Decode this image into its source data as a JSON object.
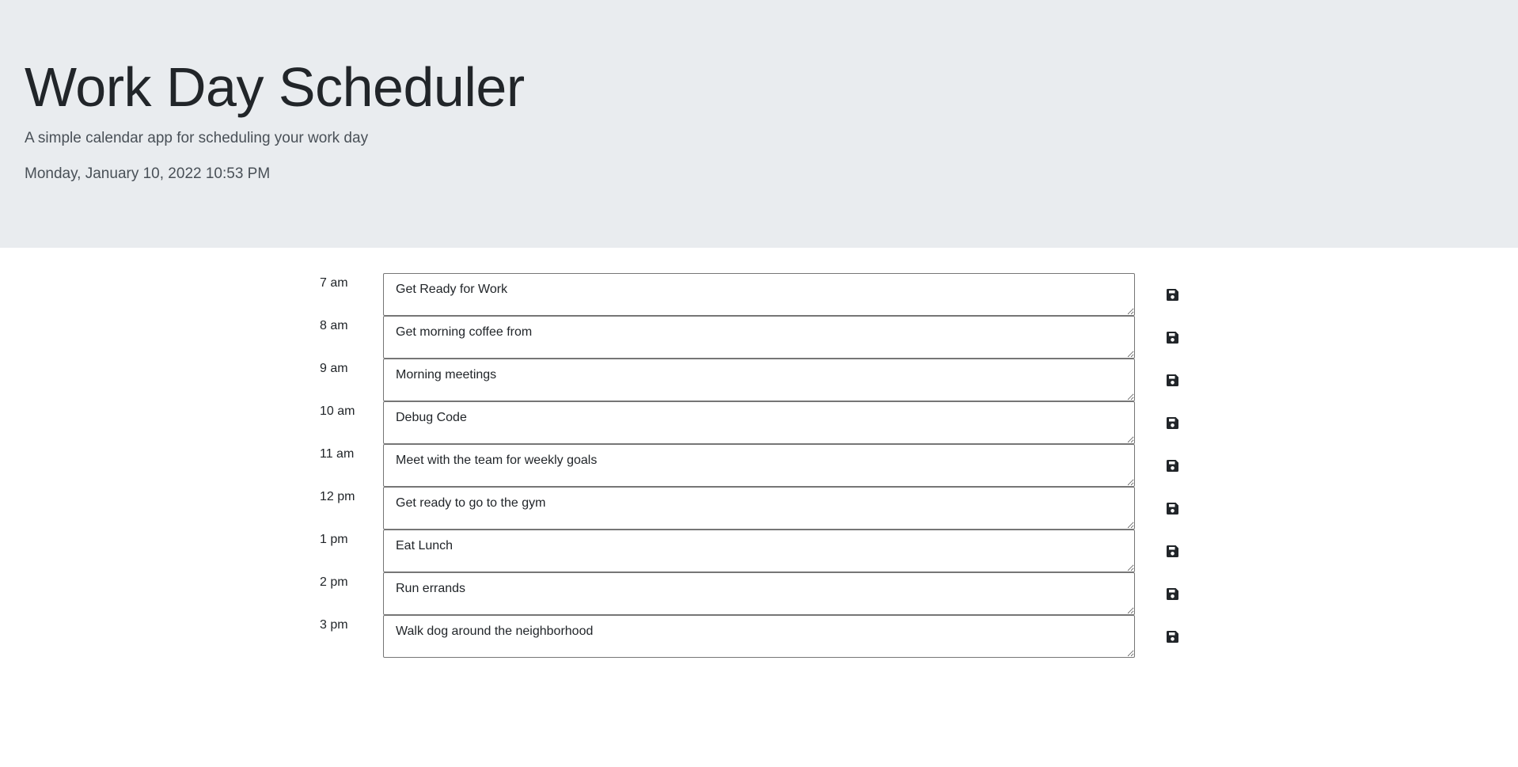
{
  "header": {
    "title": "Work Day Scheduler",
    "subtitle": "A simple calendar app for scheduling your work day",
    "current_day": "Monday, January 10, 2022 10:53 PM"
  },
  "schedule": {
    "rows": [
      {
        "hour": "7 am",
        "text": "Get Ready for Work"
      },
      {
        "hour": "8 am",
        "text": "Get morning coffee from"
      },
      {
        "hour": "9 am",
        "text": "Morning meetings"
      },
      {
        "hour": "10 am",
        "text": "Debug Code"
      },
      {
        "hour": "11 am",
        "text": "Meet with the team for weekly goals"
      },
      {
        "hour": "12 pm",
        "text": "Get ready to go to the gym"
      },
      {
        "hour": "1 pm",
        "text": "Eat Lunch"
      },
      {
        "hour": "2 pm",
        "text": "Run errands"
      },
      {
        "hour": "3 pm",
        "text": "Walk dog around the neighborhood"
      }
    ],
    "save_icon": "floppy-disk-icon"
  },
  "colors": {
    "header_background": "#e9ecef",
    "text": "#212529",
    "muted_text": "#495057",
    "textarea_border": "#767676",
    "icon": "#212529"
  }
}
